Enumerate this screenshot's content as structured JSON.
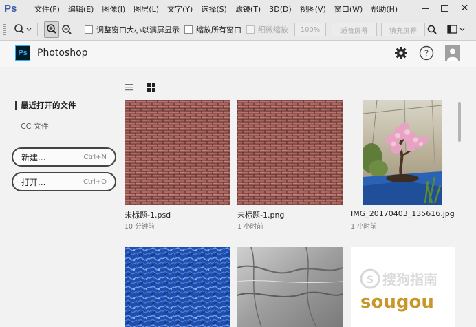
{
  "app": {
    "logo": "Ps",
    "name": "Photoshop",
    "badge": "Ps"
  },
  "menubar": {
    "items": [
      "文件(F)",
      "编辑(E)",
      "图像(I)",
      "图层(L)",
      "文字(Y)",
      "选择(S)",
      "滤镜(T)",
      "3D(D)",
      "视图(V)",
      "窗口(W)",
      "帮助(H)"
    ]
  },
  "optionsbar": {
    "resize_windows": "调整窗口大小以满屏显示",
    "zoom_all": "缩放所有窗口",
    "scrubby_zoom": "细微缩放",
    "zoom_percent": "100%",
    "fit_screen": "适合屏幕",
    "fill_screen": "填充屏幕"
  },
  "sidebar": {
    "recent": "最近打开的文件",
    "cc_files": "CC 文件",
    "new_label": "新建...",
    "new_shortcut": "Ctrl+N",
    "open_label": "打开...",
    "open_shortcut": "Ctrl+O"
  },
  "files": [
    {
      "name": "未标题-1.psd",
      "time": "10 分钟前"
    },
    {
      "name": "未标题-1.png",
      "time": "1 小时前"
    },
    {
      "name": "IMG_20170403_135616.jpg",
      "time": "1 小时前"
    }
  ],
  "watermark": {
    "brand": "sougou",
    "site": "搜狗指南"
  },
  "colors": {
    "accent": "#31a8ff",
    "brick": "#b06b66",
    "blue_texture": "#2a62c8",
    "gray_texture": "#a8a8a8"
  },
  "icons": {
    "zoom_tool": "magnifier-icon",
    "zoom_in": "zoom-in-icon",
    "zoom_out": "zoom-out-icon",
    "search": "search-icon",
    "workspace": "workspace-icon",
    "settings": "gear-icon",
    "help": "help-icon",
    "user": "avatar-icon",
    "list_view": "list-view-icon",
    "grid_view": "grid-view-icon"
  }
}
